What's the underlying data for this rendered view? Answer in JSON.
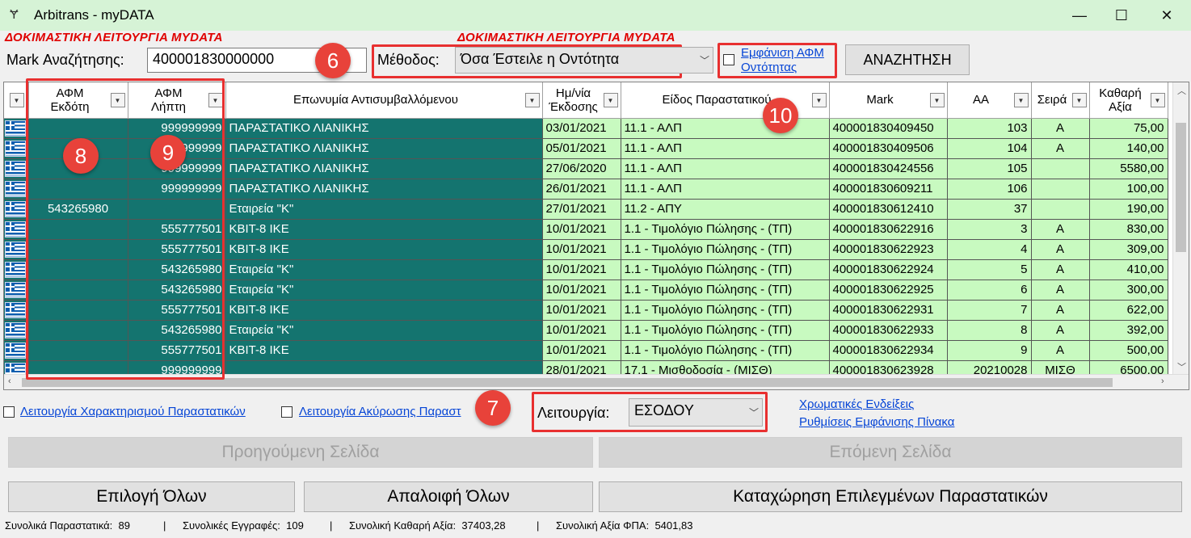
{
  "window": {
    "title": "Arbitrans - myDATA",
    "minimize": "—",
    "maximize": "☐",
    "close": "✕"
  },
  "warning_text": "ΔΟΚΙΜΑΣΤΙΚΗ ΛΕΙΤΟΥΡΓΙΑ MYDATA",
  "search": {
    "mark_label": "Mark Αναζήτησης:",
    "mark_value": "400001830000000",
    "method_label": "Μέθοδος:",
    "method_value": "Όσα Έστειλε η Οντότητα",
    "show_afm_label_line1": "Εμφάνιση ΑΦΜ",
    "show_afm_label_line2": "Οντότητας",
    "search_button": "ΑΝΑΖΗΤΗΣΗ"
  },
  "badges": {
    "b6": "6",
    "b7": "7",
    "b8": "8",
    "b9": "9",
    "b10": "10"
  },
  "grid": {
    "columns": [
      {
        "line1": "ΑΦΜ",
        "line2": "Εκδότη"
      },
      {
        "line1": "ΑΦΜ",
        "line2": "Λήπτη"
      },
      {
        "line1": "Επωνυμία Αντισυμβαλλόμενου",
        "line2": ""
      },
      {
        "line1": "Ημ/νία",
        "line2": "Έκδοσης"
      },
      {
        "line1": "Είδος Παραστατικού",
        "line2": ""
      },
      {
        "line1": "Mark",
        "line2": ""
      },
      {
        "line1": "AA",
        "line2": ""
      },
      {
        "line1": "Σειρά",
        "line2": ""
      },
      {
        "line1": "Καθαρή",
        "line2": "Αξία"
      }
    ],
    "rows": [
      {
        "issuer": "",
        "receiver": "999999999",
        "name": "ΠΑΡΑΣΤΑΤΙΚΟ ΛΙΑΝΙΚΗΣ",
        "date": "03/01/2021",
        "type": "11.1 - ΑΛΠ",
        "mark": "400001830409450",
        "aa": "103",
        "series": "A",
        "net": "75,00"
      },
      {
        "issuer": "",
        "receiver": "999999999",
        "name": "ΠΑΡΑΣΤΑΤΙΚΟ ΛΙΑΝΙΚΗΣ",
        "date": "05/01/2021",
        "type": "11.1 - ΑΛΠ",
        "mark": "400001830409506",
        "aa": "104",
        "series": "A",
        "net": "140,00"
      },
      {
        "issuer": "",
        "receiver": "999999999",
        "name": "ΠΑΡΑΣΤΑΤΙΚΟ ΛΙΑΝΙΚΗΣ",
        "date": "27/06/2020",
        "type": "11.1 - ΑΛΠ",
        "mark": "400001830424556",
        "aa": "105",
        "series": "",
        "net": "5580,00"
      },
      {
        "issuer": "",
        "receiver": "999999999",
        "name": "ΠΑΡΑΣΤΑΤΙΚΟ ΛΙΑΝΙΚΗΣ",
        "date": "26/01/2021",
        "type": "11.1 - ΑΛΠ",
        "mark": "400001830609211",
        "aa": "106",
        "series": "",
        "net": "100,00"
      },
      {
        "issuer": "543265980",
        "receiver": "",
        "name": "Εταιρεία \"Κ\"",
        "date": "27/01/2021",
        "type": "11.2 - ΑΠΥ",
        "mark": "400001830612410",
        "aa": "37",
        "series": "",
        "net": "190,00"
      },
      {
        "issuer": "",
        "receiver": "555777501",
        "name": "KBIT-8 IKE",
        "date": "10/01/2021",
        "type": "1.1 - Τιμολόγιο Πώλησης - (ΤΠ)",
        "mark": "400001830622916",
        "aa": "3",
        "series": "A",
        "net": "830,00"
      },
      {
        "issuer": "",
        "receiver": "555777501",
        "name": "KBIT-8 IKE",
        "date": "10/01/2021",
        "type": "1.1 - Τιμολόγιο Πώλησης - (ΤΠ)",
        "mark": "400001830622923",
        "aa": "4",
        "series": "A",
        "net": "309,00"
      },
      {
        "issuer": "",
        "receiver": "543265980",
        "name": "Εταιρεία \"Κ\"",
        "date": "10/01/2021",
        "type": "1.1 - Τιμολόγιο Πώλησης - (ΤΠ)",
        "mark": "400001830622924",
        "aa": "5",
        "series": "A",
        "net": "410,00"
      },
      {
        "issuer": "",
        "receiver": "543265980",
        "name": "Εταιρεία \"Κ\"",
        "date": "10/01/2021",
        "type": "1.1 - Τιμολόγιο Πώλησης - (ΤΠ)",
        "mark": "400001830622925",
        "aa": "6",
        "series": "A",
        "net": "300,00"
      },
      {
        "issuer": "",
        "receiver": "555777501",
        "name": "KBIT-8 IKE",
        "date": "10/01/2021",
        "type": "1.1 - Τιμολόγιο Πώλησης - (ΤΠ)",
        "mark": "400001830622931",
        "aa": "7",
        "series": "A",
        "net": "622,00"
      },
      {
        "issuer": "",
        "receiver": "543265980",
        "name": "Εταιρεία \"Κ\"",
        "date": "10/01/2021",
        "type": "1.1 - Τιμολόγιο Πώλησης - (ΤΠ)",
        "mark": "400001830622933",
        "aa": "8",
        "series": "A",
        "net": "392,00"
      },
      {
        "issuer": "",
        "receiver": "555777501",
        "name": "KBIT-8 IKE",
        "date": "10/01/2021",
        "type": "1.1 - Τιμολόγιο Πώλησης - (ΤΠ)",
        "mark": "400001830622934",
        "aa": "9",
        "series": "A",
        "net": "500,00"
      },
      {
        "issuer": "",
        "receiver": "999999999",
        "name": "",
        "date": "28/01/2021",
        "type": "17.1 - Μισθοδοσία - (ΜΙΣΘ)",
        "mark": "400001830623928",
        "aa": "20210028",
        "series": "ΜΙΣΘ",
        "net": "6500,00"
      }
    ]
  },
  "options": {
    "characterization_label": "Λειτουργία Χαρακτηρισμού Παραστατικών",
    "cancellation_label": "Λειτουργία Ακύρωσης Παραστ",
    "operation_label": "Λειτουργία:",
    "operation_value": "ΕΣΟΔΟΥ",
    "color_legend_link": "Χρωματικές Ενδείξεις",
    "table_settings_link": "Ρυθμίσεις Εμφάνισης Πίνακα"
  },
  "buttons": {
    "prev_page": "Προηγούμενη Σελίδα",
    "next_page": "Επόμενη Σελίδα",
    "select_all": "Επιλογή Όλων",
    "clear_all": "Απαλοιφή Όλων",
    "register_selected": "Καταχώρηση Επιλεγμένων Παραστατικών"
  },
  "status": {
    "total_docs_label": "Συνολικά Παραστατικά:",
    "total_docs": "89",
    "total_records_label": "Συνολικές Εγγραφές:",
    "total_records": "109",
    "total_net_label": "Συνολική Καθαρή Αξία:",
    "total_net": "37403,28",
    "total_vat_label": "Συνολική Αξία ΦΠΑ:",
    "total_vat": "5401,83",
    "separator": "|"
  },
  "colors": {
    "dark_row": "#14746f",
    "light_cell": "#c8fac0",
    "annotation": "#e83030",
    "titlebar": "#d6f3d6"
  }
}
